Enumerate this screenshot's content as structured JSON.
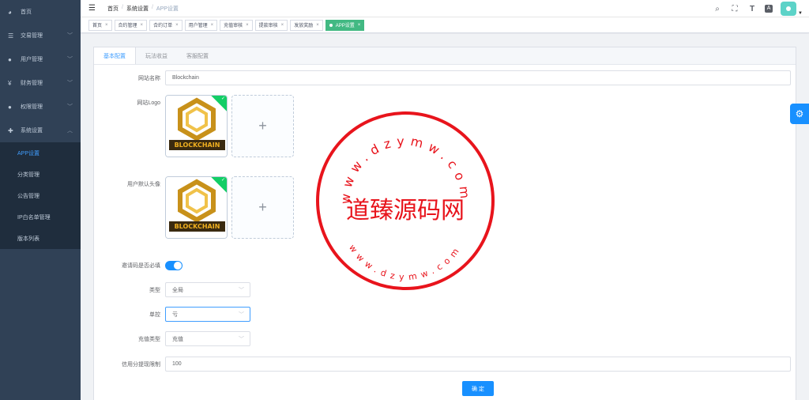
{
  "sidebar": {
    "items": [
      {
        "icon": "dashboard-icon",
        "glyph": "◕",
        "label": "首页",
        "has_arrow": false
      },
      {
        "icon": "transaction-icon",
        "glyph": "☰",
        "label": "交易管理",
        "has_arrow": true
      },
      {
        "icon": "user-icon",
        "glyph": "●",
        "label": "用户管理",
        "has_arrow": true
      },
      {
        "icon": "yen-icon",
        "glyph": "¥",
        "label": "财务管理",
        "has_arrow": true
      },
      {
        "icon": "person-icon",
        "glyph": "●",
        "label": "权限管理",
        "has_arrow": true
      },
      {
        "icon": "plus-icon",
        "glyph": "✚",
        "label": "系统设置",
        "has_arrow": true
      }
    ],
    "sub_items": [
      "APP设置",
      "分类管理",
      "公告管理",
      "IP白名单管理",
      "版本列表"
    ],
    "active_sub": "APP设置"
  },
  "topbar": {
    "breadcrumb": [
      "首页",
      "系统设置",
      "APP设置"
    ],
    "icons": [
      "search-icon",
      "fullscreen-icon",
      "font-size-icon",
      "translate-icon"
    ]
  },
  "tags": [
    {
      "label": "首页",
      "active": false
    },
    {
      "label": "合约管理",
      "active": false
    },
    {
      "label": "合约订单",
      "active": false
    },
    {
      "label": "用户管理",
      "active": false
    },
    {
      "label": "充值审核",
      "active": false
    },
    {
      "label": "提款审核",
      "active": false
    },
    {
      "label": "发放奖励",
      "active": false
    },
    {
      "label": "APP设置",
      "active": true
    }
  ],
  "tabs": [
    "基本配置",
    "玩法收益",
    "客服配置"
  ],
  "form": {
    "site_name_label": "网站名称",
    "site_name_value": "Blockchain",
    "logo_label": "网站Logo",
    "avatar_label": "用户默认头像",
    "logo_text": "BLOCKCHAIN",
    "invite_label": "邀请码是否必填",
    "invite_on": true,
    "type_label": "类型",
    "type_value": "全局",
    "unit_label": "单控",
    "unit_value": "亏",
    "recharge_label": "充值类型",
    "recharge_value": "充值",
    "credit_label": "信用分提现限制",
    "credit_value": "100",
    "confirm_label": "确 定"
  },
  "watermark": {
    "top_text": "www.dzymw.com",
    "center_text": "道臻源码网",
    "bottom_text": "www.dzymw.com",
    "color": "#e8141c"
  },
  "colors": {
    "sidebar_bg": "#304156",
    "primary": "#1890ff",
    "active_tag": "#42b983"
  }
}
